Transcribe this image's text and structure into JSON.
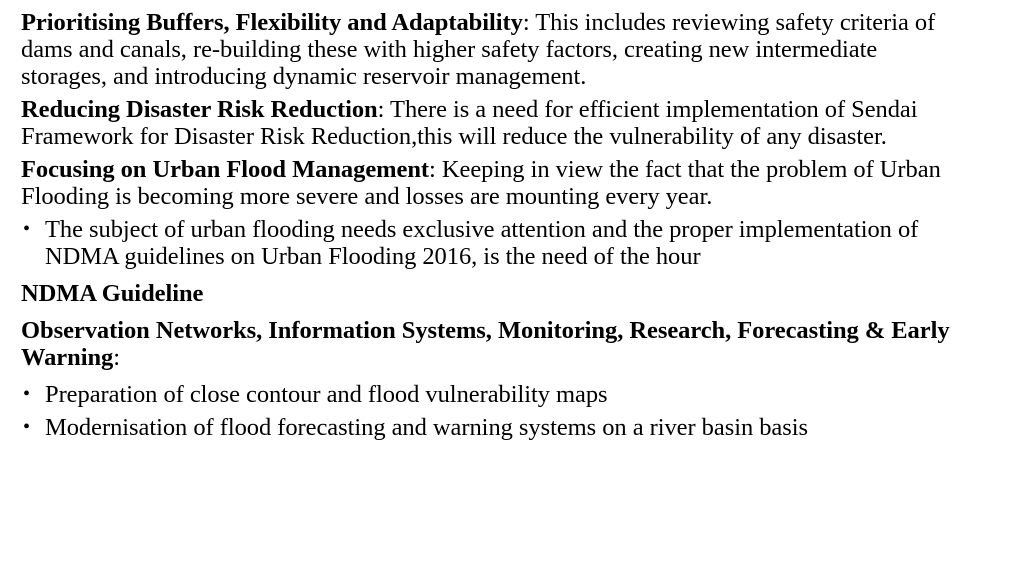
{
  "slide": {
    "background_color": "#ffffff",
    "text_color": "#000000",
    "blocks": {
      "buffers_para": {
        "lead": "Prioritising Buffers, Flexibility and Adaptability",
        "body": ": This includes reviewing safety criteria of dams and canals, re-building these with higher safety factors, creating new intermediate storages, and introducing dynamic reservoir management."
      },
      "disaster_para": {
        "lead": "Reducing Disaster Risk Reduction",
        "body": ": There is a need for efficient implementation of Sendai Framework for Disaster Risk Reduction,this will reduce the vulnerability of any disaster."
      },
      "urban_para": {
        "lead": "Focusing on Urban Flood Management",
        "body": ": Keeping in view the fact that the problem of Urban Flooding is becoming more severe and losses are mounting every year."
      },
      "urban_bullet": {
        "marker": "bullet-dot",
        "text": "The subject of urban flooding needs exclusive attention and the proper implementation of NDMA guidelines on Urban Flooding 2016, is the need of the hour"
      },
      "ndma_heading": {
        "text": "NDMA Guideline"
      },
      "observation_heading": {
        "text": "Observation Networks, Information Systems, Monitoring, Research, Forecasting & Early Warning",
        "tail": ":"
      },
      "final_bullets": [
        {
          "marker": "bullet-dot",
          "text": "Preparation of close contour and flood vulnerability maps"
        },
        {
          "marker": "bullet-dot",
          "text": "Modernisation of flood forecasting and warning systems on a river basin basis"
        }
      ]
    }
  }
}
